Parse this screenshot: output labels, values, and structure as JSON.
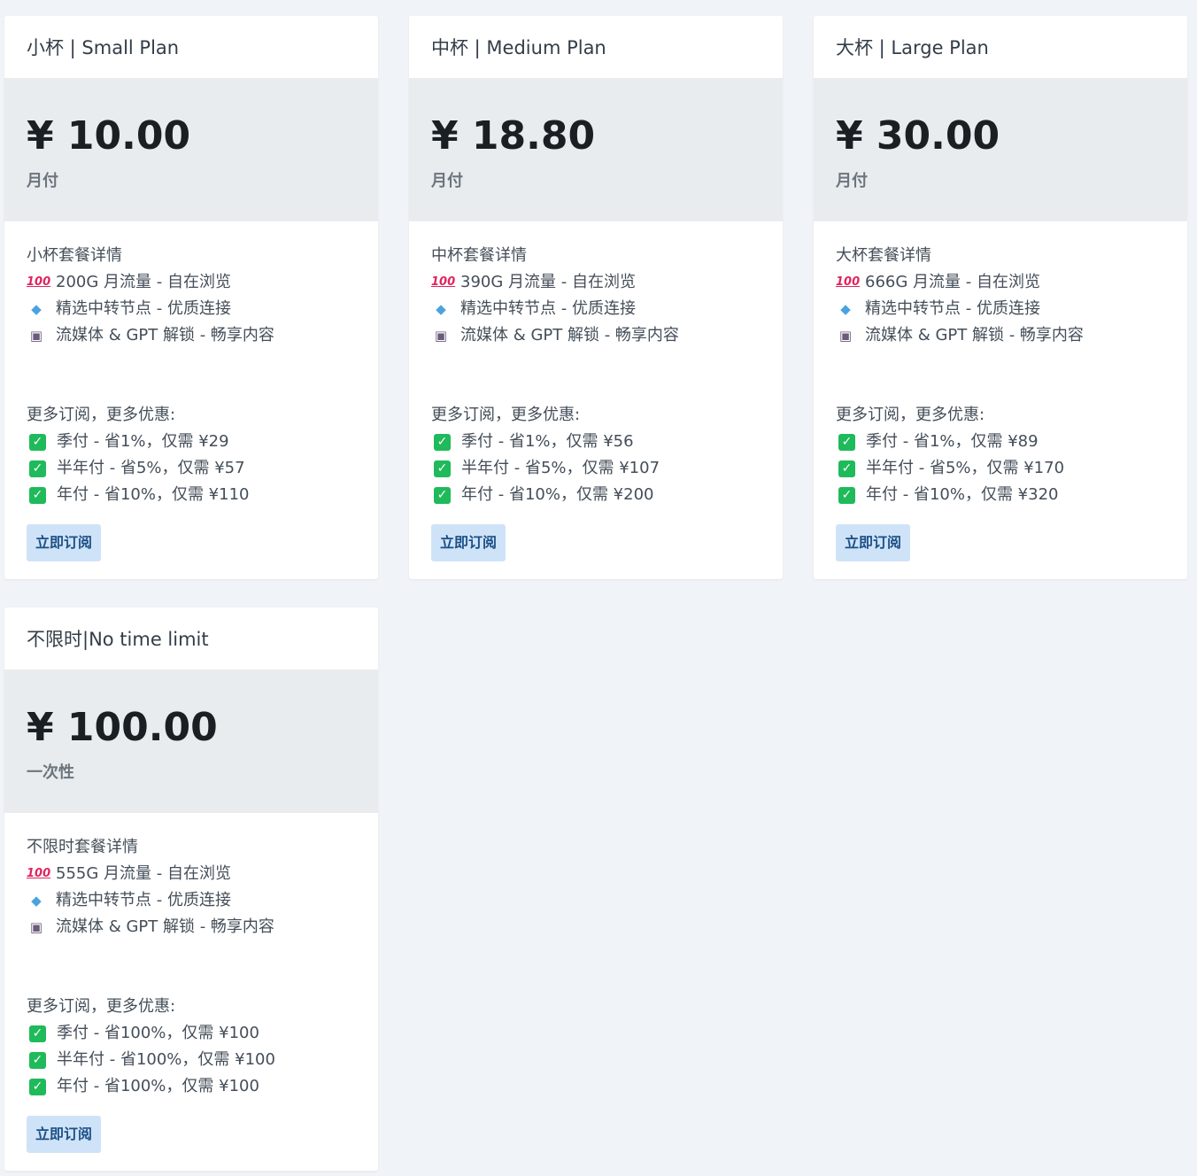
{
  "plans": [
    {
      "title": "小杯 | Small Plan",
      "price": "¥ 10.00",
      "period": "月付",
      "details_heading": "小杯套餐详情",
      "features": [
        {
          "icon": "hundred-points-icon",
          "text": "200G 月流量 - 自在浏览"
        },
        {
          "icon": "gem-icon",
          "text": "精选中转节点 - 优质连接"
        },
        {
          "icon": "television-icon",
          "text": "流媒体 & GPT 解锁 - 畅享内容"
        }
      ],
      "discount_heading": "更多订阅，更多优惠:",
      "discounts": [
        "季付 - 省1%，仅需 ¥29",
        "半年付 - 省5%，仅需 ¥57",
        "年付 - 省10%，仅需 ¥110"
      ],
      "button": "立即订阅"
    },
    {
      "title": "中杯 | Medium Plan",
      "price": "¥ 18.80",
      "period": "月付",
      "details_heading": "中杯套餐详情",
      "features": [
        {
          "icon": "hundred-points-icon",
          "text": "390G 月流量 - 自在浏览"
        },
        {
          "icon": "gem-icon",
          "text": "精选中转节点 - 优质连接"
        },
        {
          "icon": "television-icon",
          "text": "流媒体 & GPT 解锁 - 畅享内容"
        }
      ],
      "discount_heading": "更多订阅，更多优惠:",
      "discounts": [
        "季付 - 省1%，仅需 ¥56",
        "半年付 - 省5%，仅需 ¥107",
        "年付 - 省10%，仅需 ¥200"
      ],
      "button": "立即订阅"
    },
    {
      "title": "大杯 | Large Plan",
      "price": "¥ 30.00",
      "period": "月付",
      "details_heading": "大杯套餐详情",
      "features": [
        {
          "icon": "hundred-points-icon",
          "text": "666G 月流量 - 自在浏览"
        },
        {
          "icon": "gem-icon",
          "text": "精选中转节点 - 优质连接"
        },
        {
          "icon": "television-icon",
          "text": "流媒体 & GPT 解锁 - 畅享内容"
        }
      ],
      "discount_heading": "更多订阅，更多优惠:",
      "discounts": [
        "季付 - 省1%，仅需 ¥89",
        "半年付 - 省5%，仅需 ¥170",
        "年付 - 省10%，仅需 ¥320"
      ],
      "button": "立即订阅"
    },
    {
      "title": "不限时|No time limit",
      "price": "¥ 100.00",
      "period": "一次性",
      "details_heading": "不限时套餐详情",
      "features": [
        {
          "icon": "hundred-points-icon",
          "text": "555G 月流量 - 自在浏览"
        },
        {
          "icon": "gem-icon",
          "text": "精选中转节点 - 优质连接"
        },
        {
          "icon": "television-icon",
          "text": "流媒体 & GPT 解锁 - 畅享内容"
        }
      ],
      "discount_heading": "更多订阅，更多优惠:",
      "discounts": [
        "季付 - 省100%，仅需 ¥100",
        "半年付 - 省100%，仅需 ¥100",
        "年付 - 省100%，仅需 ¥100"
      ],
      "button": "立即订阅"
    }
  ],
  "colors": {
    "background": "#f0f3f7",
    "price_band": "#e9ecef",
    "check": "#1fba5a",
    "button_bg": "#cfe3f8",
    "button_text": "#1c4f85"
  }
}
